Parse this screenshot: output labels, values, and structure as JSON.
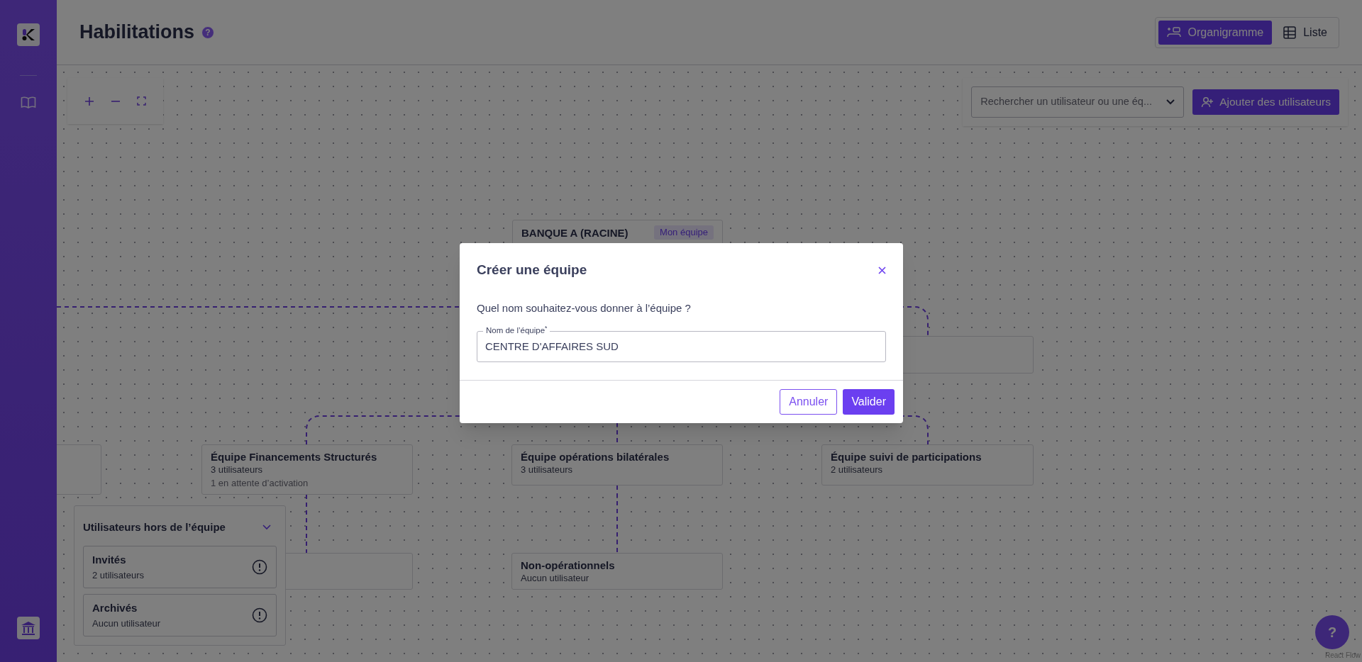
{
  "sidebar": {
    "nav": [
      {
        "kind": "logo"
      },
      {
        "kind": "docs"
      }
    ],
    "footer": {
      "kind": "bank"
    }
  },
  "header": {
    "title": "Habilitations",
    "help": "?",
    "view_tabs": [
      {
        "label": "Organigramme",
        "kind": "chart",
        "selected": true
      },
      {
        "label": "Liste",
        "kind": "table",
        "selected": false
      }
    ]
  },
  "toolbar": {
    "search": {
      "placeholder": "Rechercher un utilisateur ou une éq..."
    },
    "add_button": "Ajouter des utilisateurs"
  },
  "org_chart": {
    "nodes": [
      {
        "kind": "team",
        "title": "BANQUE A (RACINE)",
        "badge": "Mon équipe"
      },
      {
        "kind": "hidden"
      },
      {
        "kind": "hidden"
      },
      {
        "kind": "team",
        "title": "Équipe Financements Structurés",
        "lines": [
          "3 utilisateurs",
          "1 en attente d’activation"
        ]
      },
      {
        "kind": "team",
        "title": "Équipe opérations bilatérales",
        "lines": [
          "3 utilisateurs"
        ]
      },
      {
        "kind": "team",
        "title": "Équipe suivi de participations",
        "lines": [
          "2 utilisateurs"
        ]
      },
      {
        "kind": "hidden"
      },
      {
        "kind": "team",
        "title": "Non-opérationnels",
        "lines": [
          "Aucun utilisateur"
        ]
      }
    ]
  },
  "outside_panel": {
    "title": "Utilisateurs hors de l’équipe",
    "expanded": true,
    "groups": [
      {
        "title": "Invités",
        "subtitle": "2 utilisateurs"
      },
      {
        "title": "Archivés",
        "subtitle": "Aucun utilisateur"
      }
    ]
  },
  "dialog": {
    "title": "Créer une équipe",
    "question": "Quel nom souhaitez-vous donner à l’équipe ?",
    "field": {
      "label": "Nom de l’équipe$^{*}$",
      "value": "CENTRE D'AFFAIRES SUD"
    },
    "buttons": [
      {
        "label": "Annuler",
        "kind": "secondary"
      },
      {
        "label": "Valider",
        "kind": "primary"
      }
    ]
  },
  "help_button": "?",
  "attribution": "React Flow"
}
